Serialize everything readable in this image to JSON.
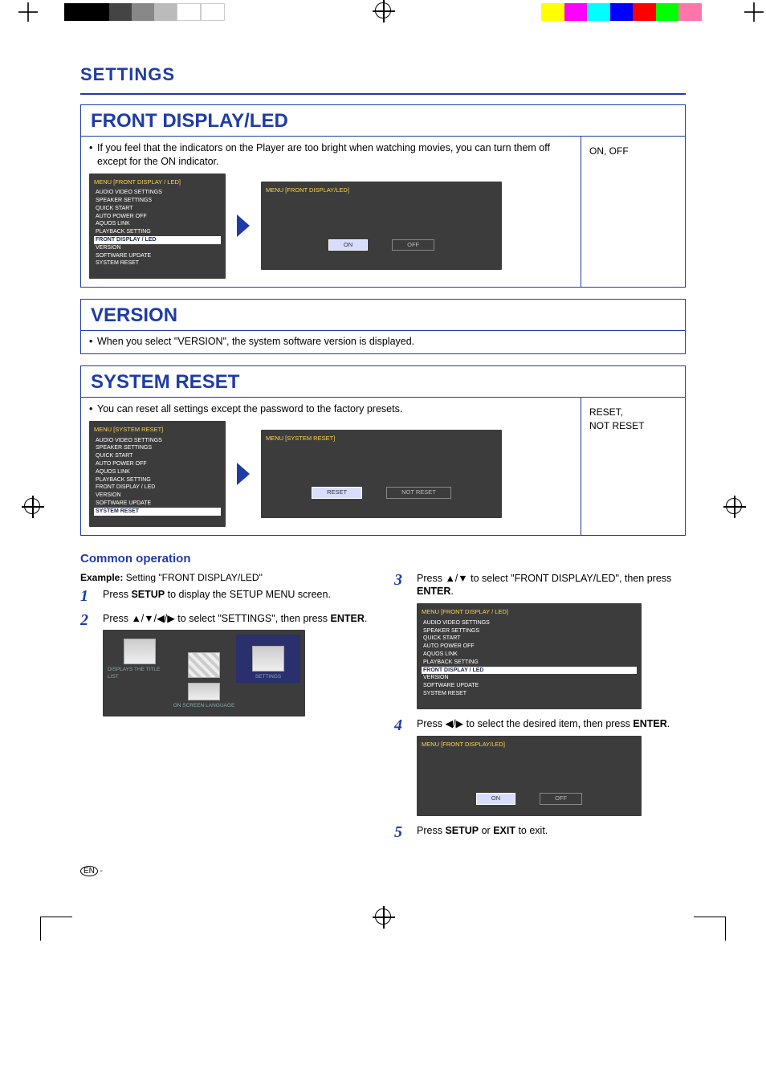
{
  "header": {
    "settings": "SETTINGS"
  },
  "sections": {
    "fdl": {
      "title": "FRONT DISPLAY/LED",
      "desc": "If you feel that the indicators on the Player are too bright when watching movies, you can turn them off except for the ON indicator.",
      "right": "ON, OFF",
      "osd1": {
        "hdr": "MENU   [FRONT DISPLAY / LED]",
        "items": [
          "AUDIO VIDEO SETTINGS",
          "SPEAKER SETTINGS",
          "QUICK START",
          "AUTO POWER OFF",
          "AQUOS LINK",
          "PLAYBACK SETTING",
          "FRONT DISPLAY / LED",
          "VERSION",
          "SOFTWARE UPDATE",
          "SYSTEM RESET"
        ],
        "hl_index": 6
      },
      "osd2": {
        "hdr": "MENU   [FRONT DISPLAY/LED]",
        "opt_on": "ON",
        "opt_off": "OFF"
      }
    },
    "ver": {
      "title": "VERSION",
      "desc": "When you select \"VERSION\", the system software version is displayed."
    },
    "sr": {
      "title": "SYSTEM RESET",
      "desc": "You can reset all settings except the password to the factory presets.",
      "right": "RESET,\nNOT RESET",
      "osd1": {
        "hdr": "MENU   [SYSTEM RESET]",
        "items": [
          "AUDIO VIDEO SETTINGS",
          "SPEAKER SETTINGS",
          "QUICK START",
          "AUTO POWER OFF",
          "AQUOS LINK",
          "PLAYBACK SETTING",
          "FRONT DISPLAY / LED",
          "VERSION",
          "SOFTWARE UPDATE",
          "SYSTEM RESET"
        ],
        "hl_index": 9
      },
      "osd2": {
        "hdr": "MENU   [SYSTEM RESET]",
        "opt_reset": "RESET",
        "opt_notreset": "NOT RESET"
      }
    }
  },
  "common": {
    "heading": "Common operation",
    "example_label": "Example:",
    "example_text": " Setting \"FRONT DISPLAY/LED\"",
    "step1": {
      "pre": "Press ",
      "key": "SETUP",
      "post": " to display the SETUP MENU screen."
    },
    "step2": {
      "pre": "Press ",
      "glyph": "▲/▼/◀/▶",
      "post": " to select \"SETTINGS\", then press ",
      "key": "ENTER",
      "post2": "."
    },
    "step3": {
      "pre": "Press ",
      "glyph": "▲/▼",
      "post": " to select \"FRONT DISPLAY/LED\", then press ",
      "key": "ENTER",
      "post2": "."
    },
    "step4": {
      "pre": "Press ",
      "glyph": "◀/▶",
      "post": " to select the desired item, then press ",
      "key": "ENTER",
      "post2": "."
    },
    "step5": {
      "pre": "Press ",
      "key1": "SETUP",
      "mid": " or ",
      "key2": "EXIT",
      "post": " to exit."
    },
    "setup_menu": {
      "cells": [
        "DISPLAYS THE TITLE LIST",
        "",
        "SETTINGS",
        "ON SCREEN LANGUAGE",
        "",
        ""
      ]
    },
    "osd3": {
      "hdr": "MENU   [FRONT DISPLAY / LED]",
      "items": [
        "AUDIO VIDEO SETTINGS",
        "SPEAKER SETTINGS",
        "QUICK START",
        "AUTO POWER OFF",
        "AQUOS LINK",
        "PLAYBACK SETTING",
        "FRONT DISPLAY / LED",
        "VERSION",
        "SOFTWARE UPDATE",
        "SYSTEM RESET"
      ],
      "hl_index": 6
    },
    "osd4": {
      "hdr": "MENU   [FRONT DISPLAY/LED]",
      "opt_on": "ON",
      "opt_off": "OFF"
    }
  },
  "footer": {
    "en": "EN",
    "dash": " -"
  }
}
